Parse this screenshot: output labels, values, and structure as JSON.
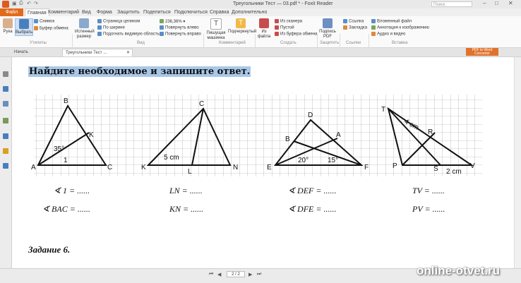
{
  "titlebar": {
    "title": "Треугольники  Тест — 03.pdf * - Foxit Reader",
    "search_placeholder": "Поиск",
    "qa_icons": [
      "save-icon",
      "print-icon",
      "undo-icon",
      "redo-icon"
    ]
  },
  "menu": {
    "file": "Файл",
    "items": [
      "Главная",
      "Комментарий",
      "Вид",
      "Форма",
      "Защитить",
      "Поделиться",
      "Подключиться",
      "Справка",
      "Дополнительно"
    ]
  },
  "ribbon": {
    "hand": "Рука",
    "select": "Выбрать",
    "snapshot": "Снимок",
    "clipboard": "Буфер обмена",
    "actual_size": "Истинный размер",
    "fit_page": "Страница целиком",
    "fit_width": "По ширине",
    "fit_visible": "Подогнать видимую область",
    "zoom": "236,36%",
    "rotate_left": "Повернуть влево",
    "rotate_right": "Повернуть вправо",
    "typewriter": "Пишущая машинка",
    "highlight": "Подчеркнутый",
    "from_file": "Из файла",
    "from_scanner": "Из сканера",
    "blank": "Пустой",
    "from_clipboard": "Из буфера обмена",
    "sign": "Подпись PDF",
    "link": "Ссылка",
    "bookmark": "Закладка",
    "attach": "Вложенный файл",
    "image_annot": "Аннотация к изображению",
    "audio_video": "Аудио и видео",
    "groups": [
      "Утилиты",
      "Вид",
      "Комментарий",
      "Создать",
      "Защитить",
      "Ссылки",
      "Вставка"
    ]
  },
  "tabs": {
    "start": "Начать",
    "doc": "Треугольники  Тест ..."
  },
  "promo": "PDF to Word Converter",
  "document": {
    "heading": "Найдите необходимое и запишите ответ.",
    "answers": [
      "∢ 1 = ......",
      "LN = ......",
      "∢ DEF = ......",
      "TV = ......",
      "∢ BAC = ......",
      "KN = ......",
      "∢ DFE = ......",
      "PV = ......"
    ],
    "figure_labels": {
      "fig1": [
        "B",
        "A",
        "C",
        "K",
        "35°",
        "1"
      ],
      "fig2": [
        "C",
        "K",
        "L",
        "N",
        "5 cm"
      ],
      "fig3": [
        "D",
        "B",
        "A",
        "E",
        "F",
        "20°",
        "15°"
      ],
      "fig4": [
        "T",
        "R",
        "P",
        "S",
        "V",
        "4 cm",
        "2 cm"
      ]
    },
    "task": "Задание 6."
  },
  "status": {
    "page": "2 / 2"
  },
  "watermark": "online-otvet.ru"
}
